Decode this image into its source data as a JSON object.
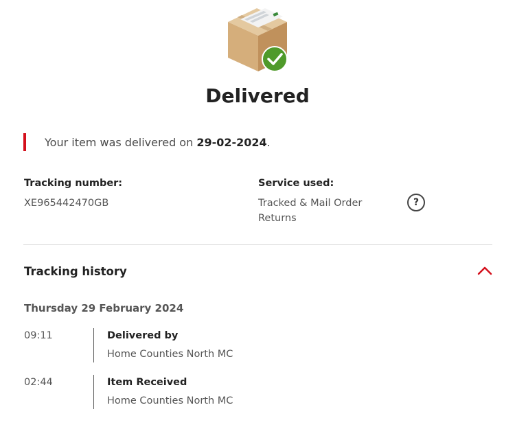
{
  "status": {
    "title": "Delivered",
    "illustration": "parcel-delivered-icon"
  },
  "notice": {
    "prefix": "Your item was delivered on ",
    "date": "29-02-2024",
    "suffix": ".",
    "accent_color": "#d4101c"
  },
  "tracking": {
    "number_label": "Tracking number:",
    "number_value": "XE965442470GB",
    "service_label": "Service used:",
    "service_value": "Tracked & Mail Order Returns",
    "help_icon": "question-circle-icon"
  },
  "history": {
    "heading": "Tracking history",
    "toggle_icon": "chevron-up-icon",
    "date": "Thursday 29 February 2024",
    "events": [
      {
        "time": "09:11",
        "title": "Delivered by",
        "location": "Home Counties North MC"
      },
      {
        "time": "02:44",
        "title": "Item Received",
        "location": "Home Counties North MC"
      }
    ]
  },
  "colors": {
    "brand_red": "#d4101c",
    "success_green": "#4f9a2a"
  }
}
